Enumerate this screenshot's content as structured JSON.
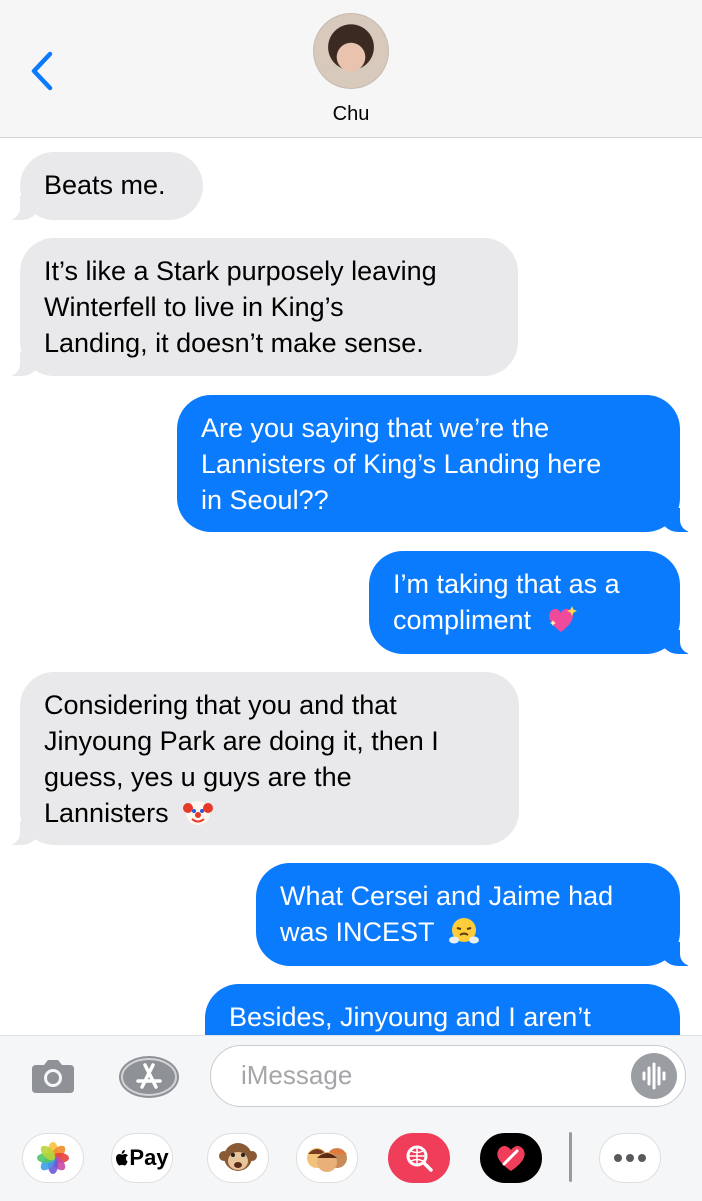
{
  "header": {
    "contact_name": "Chu",
    "back_icon": "chevron-left-icon",
    "avatar_icon": "contact-avatar"
  },
  "messages": [
    {
      "from": "them",
      "lines": [
        "Beats me."
      ]
    },
    {
      "from": "them",
      "lines": [
        "It’s like a Stark purposely leaving",
        "Winterfell to live in King’s",
        "Landing, it doesn’t make sense."
      ]
    },
    {
      "from": "me",
      "lines": [
        "Are you saying that we’re the",
        "Lannisters of King’s Landing here",
        "in Seoul??"
      ]
    },
    {
      "from": "me",
      "lines": [
        "I’m taking that as a",
        "compliment"
      ],
      "emoji": "sparkling-heart"
    },
    {
      "from": "them",
      "lines": [
        "Considering that you and that",
        "Jinyoung Park are doing it, then I",
        "guess, yes u guys are the",
        "Lannisters"
      ],
      "emoji": "clown-face"
    },
    {
      "from": "me",
      "lines": [
        "What Cersei and Jaime had",
        "was INCEST"
      ],
      "emoji": "face-with-steam"
    },
    {
      "from": "me",
      "lines": [
        "Besides, Jinyoung and I aren’t"
      ]
    }
  ],
  "composer": {
    "placeholder": "iMessage",
    "camera_icon": "camera-icon",
    "appstore_icon": "app-store-icon",
    "audio_icon": "waveform-icon"
  },
  "app_drawer": {
    "items": [
      "photos-icon",
      "apple-pay",
      "animoji-monkey-icon",
      "memoji-icon",
      "web-search-icon",
      "digital-touch-icon",
      "more-icon"
    ],
    "apple_pay_label": "Pay"
  },
  "colors": {
    "sent_bubble": "#0b7bfe",
    "received_bubble": "#e9e9eb",
    "header_bg": "#f6f6f6",
    "accent": "#0a7aff"
  }
}
